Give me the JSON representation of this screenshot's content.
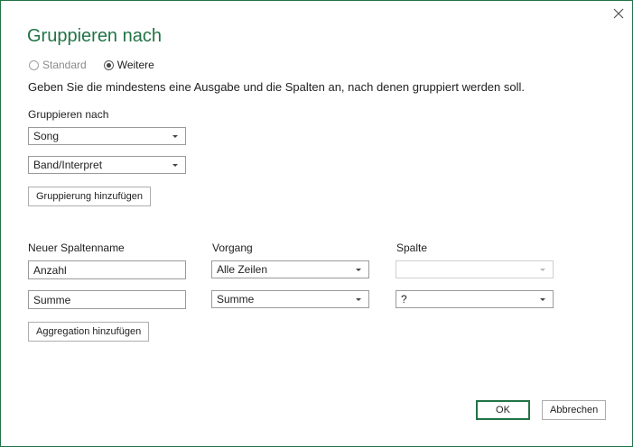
{
  "dialog": {
    "title": "Gruppieren nach",
    "close_icon": "close-icon",
    "accent_color": "#217346"
  },
  "mode": {
    "options": [
      {
        "label": "Standard",
        "selected": false,
        "enabled": false
      },
      {
        "label": "Weitere",
        "selected": true,
        "enabled": true
      }
    ]
  },
  "description": "Geben Sie die mindestens eine Ausgabe und die Spalten an, nach denen gruppiert werden soll.",
  "grouping": {
    "label": "Gruppieren nach",
    "selects": [
      {
        "value": "Song"
      },
      {
        "value": "Band/Interpret"
      }
    ],
    "add_button": "Gruppierung hinzufügen"
  },
  "aggregation": {
    "headers": {
      "name": "Neuer Spaltenname",
      "operation": "Vorgang",
      "column": "Spalte"
    },
    "rows": [
      {
        "name": "Anzahl",
        "operation": "Alle Zeilen",
        "column": "",
        "column_enabled": false
      },
      {
        "name": "Summe",
        "operation": "Summe",
        "column": "?",
        "column_enabled": true
      }
    ],
    "add_button": "Aggregation hinzufügen"
  },
  "footer": {
    "ok": "OK",
    "cancel": "Abbrechen"
  }
}
